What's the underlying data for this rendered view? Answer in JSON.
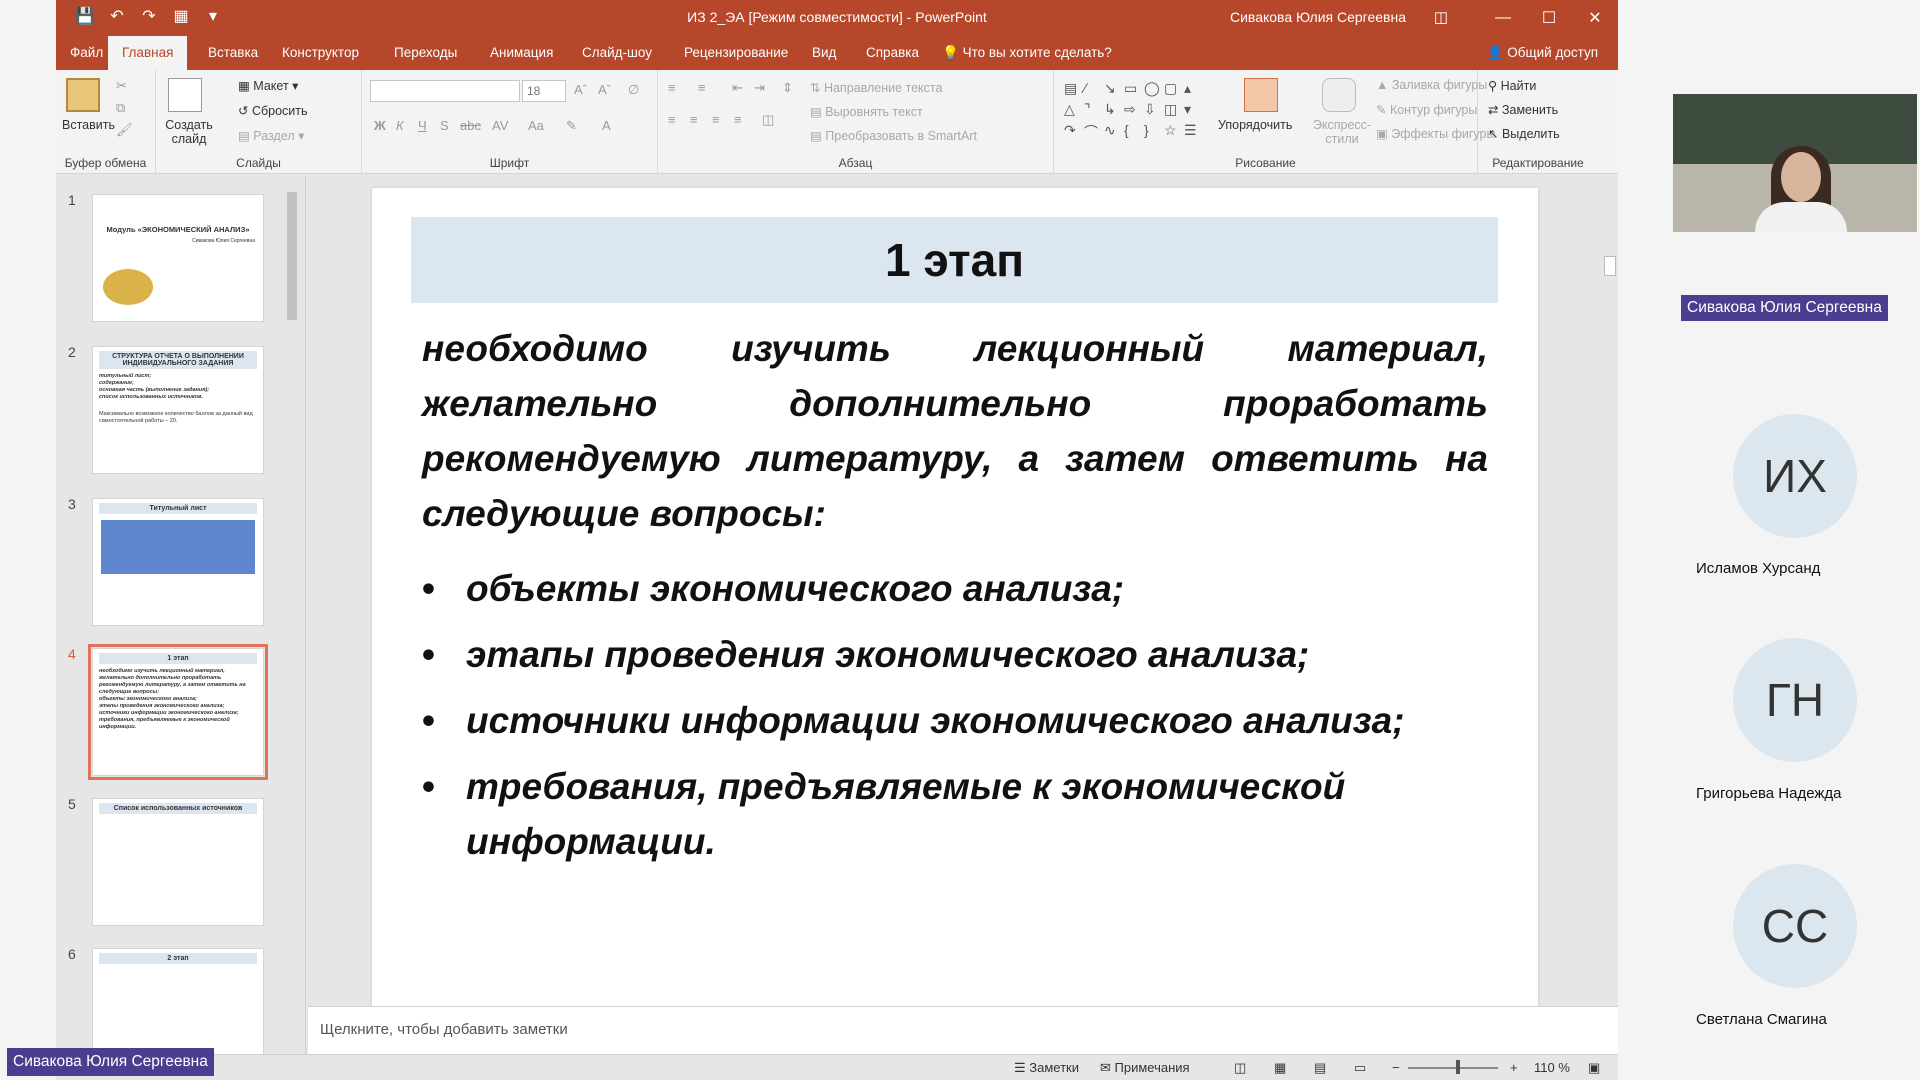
{
  "window": {
    "title": "ИЗ 2_ЭА [Режим совместимости]  -  PowerPoint",
    "user": "Сивакова Юлия Сергеевна"
  },
  "menu": {
    "tabs": [
      "Файл",
      "Главная",
      "Вставка",
      "Конструктор",
      "Переходы",
      "Анимация",
      "Слайд-шоу",
      "Рецензирование",
      "Вид",
      "Справка"
    ],
    "active_tab": "Главная",
    "tell_me": "Что вы хотите сделать?",
    "share": "Общий доступ"
  },
  "ribbon": {
    "clipboard": {
      "paste": "Вставить",
      "label": "Буфер обмена"
    },
    "slides": {
      "new_slide": "Создать слайд",
      "layout": "Макет",
      "reset": "Сбросить",
      "section": "Раздел",
      "label": "Слайды"
    },
    "font": {
      "font_size": "18",
      "label": "Шрифт"
    },
    "paragraph": {
      "text_direction": "Направление текста",
      "align_text": "Выровнять текст",
      "smartart": "Преобразовать в SmartArt",
      "label": "Абзац"
    },
    "drawing": {
      "arrange": "Упорядочить",
      "quick_styles": "Экспресс-стили",
      "shape_fill": "Заливка фигуры",
      "shape_outline": "Контур фигуры",
      "shape_effects": "Эффекты фигуры",
      "label": "Рисование"
    },
    "editing": {
      "find": "Найти",
      "replace": "Заменить",
      "select": "Выделить",
      "label": "Редактирование"
    }
  },
  "thumbnails": [
    {
      "num": "1",
      "title": "Модуль «ЭКОНОМИЧЕСКИЙ АНАЛИЗ»",
      "sub": "Сивакова Юлия Сергеевна"
    },
    {
      "num": "2",
      "title": "СТРУКТУРА ОТЧЕТА О ВЫПОЛНЕНИИ ИНДИВИДУАЛЬНОГО ЗАДАНИЯ",
      "lines": [
        "титульный лист;",
        "содержание;",
        "основная часть (выполнение задания);",
        "список использованных источников.",
        "Максимально возможное количество баллов за данный вид самостоятельной работы – 20."
      ]
    },
    {
      "num": "3",
      "title": "Титульный лист"
    },
    {
      "num": "4",
      "title": "1 этап"
    },
    {
      "num": "5",
      "title": "Список использованных источников"
    },
    {
      "num": "6",
      "title": "2 этап"
    }
  ],
  "slide": {
    "title": "1 этап",
    "body": "необходимо изучить лекционный материал, желательно дополнительно проработать рекомендуемую литературу, а затем ответить на следующие вопросы:",
    "bullets": [
      " объекты экономического анализа;",
      "этапы проведения экономического анализа;",
      "источники информации экономического анализа;",
      "требования, предъявляемые к экономической информации."
    ]
  },
  "notes_placeholder": "Щелкните, чтобы добавить заметки",
  "status": {
    "notes": "Заметки",
    "comments": "Примечания",
    "zoom": "110 %"
  },
  "conference": {
    "presenter_tag": "Сивакова Юлия Сергеевна",
    "cam_tag": "Сивакова Юлия Сергеевна",
    "participants": [
      {
        "initials": "ИХ",
        "name": "Исламов Хурсанд"
      },
      {
        "initials": "ГН",
        "name": "Григорьева Надежда"
      },
      {
        "initials": "СС",
        "name": "Светлана Смагина"
      }
    ]
  }
}
